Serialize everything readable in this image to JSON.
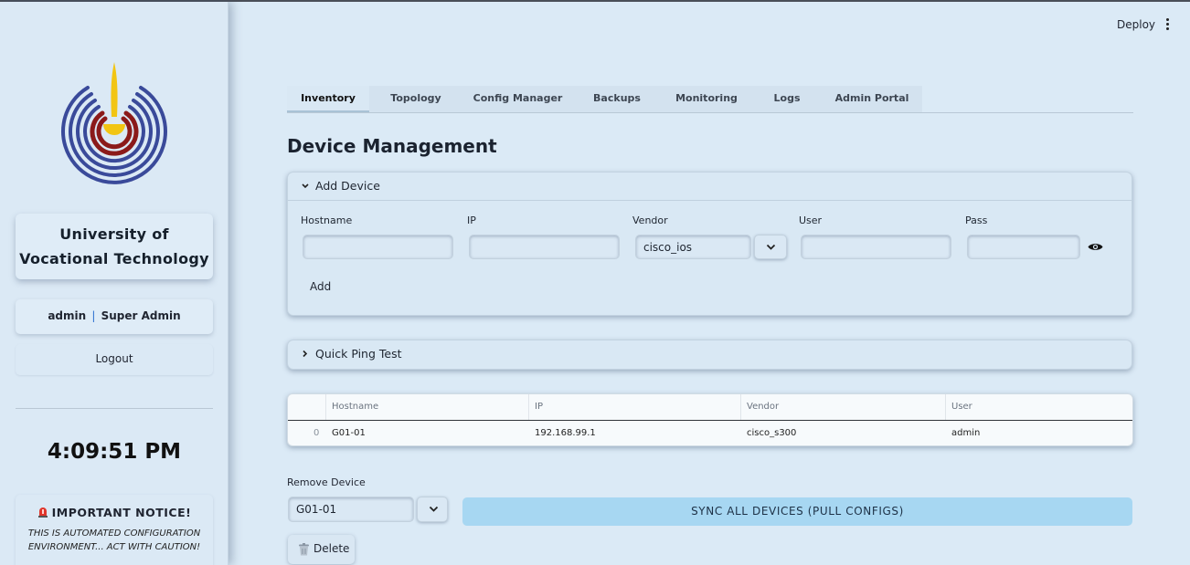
{
  "sidebar": {
    "university_line1": "University of",
    "university_line2": "Vocational Technology",
    "user_name": "admin",
    "user_separator": "|",
    "user_role": "Super Admin",
    "logout_label": "Logout",
    "clock": "4:09:51 PM",
    "notice_title": "IMPORTANT NOTICE!",
    "notice_line1": "THIS IS AUTOMATED CONFIGURATION",
    "notice_line2": "ENVIRONMENT... ACT WITH CAUTION!"
  },
  "header": {
    "deploy_label": "Deploy"
  },
  "tabs": [
    {
      "label": "Inventory",
      "active": true
    },
    {
      "label": "Topology"
    },
    {
      "label": "Config Manager"
    },
    {
      "label": "Backups"
    },
    {
      "label": "Monitoring"
    },
    {
      "label": "Logs"
    },
    {
      "label": "Admin Portal"
    }
  ],
  "main": {
    "title": "Device Management",
    "add_device": {
      "header": "Add Device",
      "expanded": true,
      "hostname_label": "Hostname",
      "hostname_value": "",
      "ip_label": "IP",
      "ip_value": "",
      "vendor_label": "Vendor",
      "vendor_value": "cisco_ios",
      "user_label": "User",
      "user_value": "",
      "pass_label": "Pass",
      "pass_value": "",
      "add_label": "Add"
    },
    "quick_ping": {
      "header": "Quick Ping Test",
      "expanded": false
    },
    "table": {
      "columns": [
        "",
        "Hostname",
        "IP",
        "Vendor",
        "User"
      ],
      "rows": [
        [
          "0",
          "G01-01",
          "192.168.99.1",
          "cisco_s300",
          "admin"
        ]
      ]
    },
    "remove": {
      "label": "Remove Device",
      "selected": "G01-01"
    },
    "sync_label": "SYNC ALL DEVICES (PULL CONFIGS)",
    "delete_label": "Delete"
  },
  "colors": {
    "background": "#dbeaf6",
    "sync_button": "#a7d7f2",
    "logo_blue": "#3a4a9a",
    "logo_red": "#8b1a1a",
    "logo_yellow": "#f2c514"
  }
}
